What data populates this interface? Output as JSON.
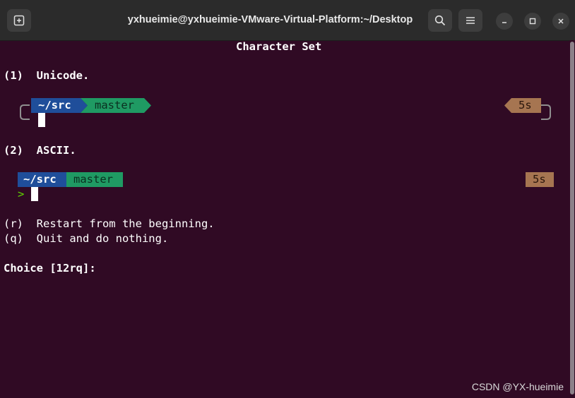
{
  "window": {
    "title": "yxhueimie@yxhueimie-VMware-Virtual-Platform:~/Desktop"
  },
  "terminal": {
    "heading": "Character Set",
    "option1_label": "(1)  Unicode.",
    "option1_prompt": {
      "dir": "~/src",
      "branch": "master",
      "duration": "5s"
    },
    "option2_label": "(2)  ASCII.",
    "option2_prompt": {
      "dir": "~/src",
      "branch": "master",
      "duration": "5s",
      "prompt_char": ">"
    },
    "restart_line": "(r)  Restart from the beginning.",
    "quit_line": "(q)  Quit and do nothing.",
    "choice_prompt": "Choice [12rq]:"
  },
  "watermark": "CSDN @YX-hueimie",
  "colors": {
    "terminal_bg": "#300a24",
    "dir_segment": "#1f4e9a",
    "branch_segment": "#1f9a63",
    "branch_text": "#0b2f20",
    "duration_segment": "#a67551",
    "duration_text": "#2a160c",
    "prompt_char": "#5fd700"
  }
}
